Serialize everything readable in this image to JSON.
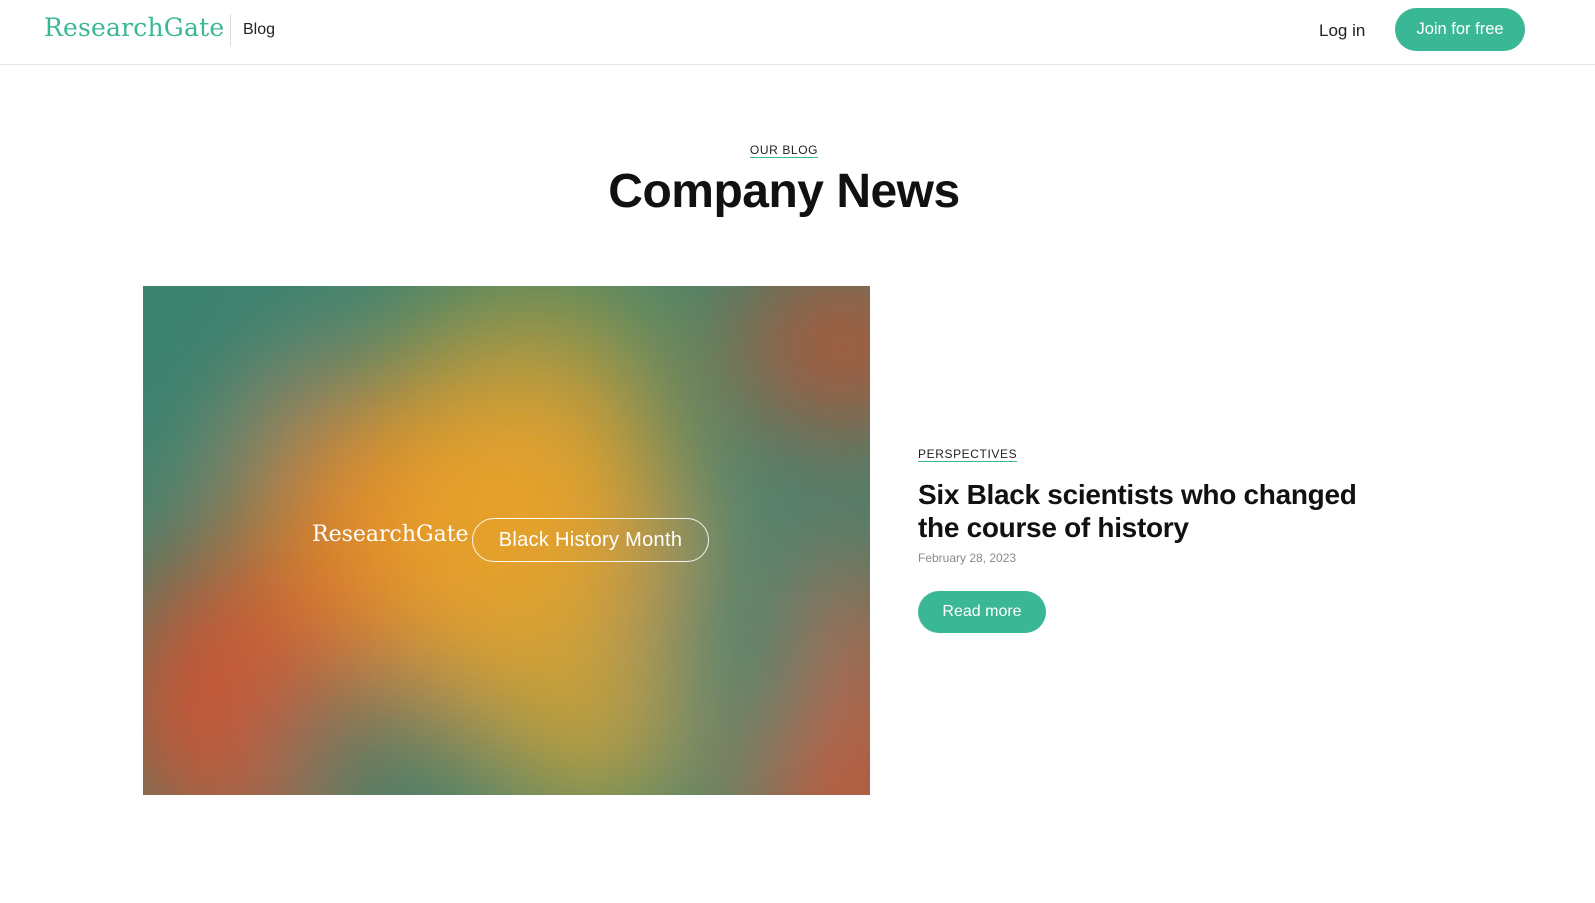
{
  "header": {
    "logo_text": "ResearchGate",
    "nav_blog": "Blog",
    "login_label": "Log in",
    "join_label": "Join for free"
  },
  "intro": {
    "eyebrow": "OUR BLOG",
    "title": "Company News"
  },
  "featured": {
    "image": {
      "brand_text": "ResearchGate",
      "pill_text": "Black History Month"
    },
    "category": "PERSPECTIVES",
    "title": "Six Black scientists who changed the course of history",
    "date": "February 28, 2023",
    "read_more_label": "Read more"
  },
  "colors": {
    "accent": "#3ab795",
    "text": "#111111",
    "muted": "#8a8a8a"
  }
}
